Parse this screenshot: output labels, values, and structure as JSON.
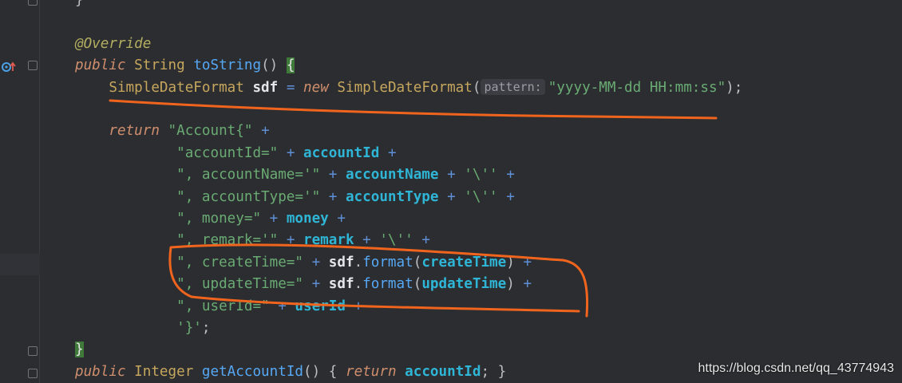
{
  "code_lines": [
    {
      "tokens": [
        {
          "t": "}",
          "c": "pn"
        }
      ]
    },
    {
      "tokens": []
    },
    {
      "tokens": [
        {
          "t": "@Override",
          "c": "ann"
        }
      ]
    },
    {
      "tokens": [
        {
          "t": "public ",
          "c": "kw"
        },
        {
          "t": "String ",
          "c": "ty"
        },
        {
          "t": "toString",
          "c": "fn"
        },
        {
          "t": "() ",
          "c": "pn"
        },
        {
          "t": "{",
          "c": "bracematch"
        }
      ]
    },
    {
      "tokens": [
        {
          "t": "    SimpleDateFormat ",
          "c": "ty"
        },
        {
          "t": "sdf ",
          "c": "loc"
        },
        {
          "t": "= ",
          "c": "op"
        },
        {
          "t": "new ",
          "c": "kw-new"
        },
        {
          "t": "SimpleDateFormat",
          "c": "ty"
        },
        {
          "t": "(",
          "c": "pn"
        },
        {
          "t": "pattern:",
          "c": "hint"
        },
        {
          "t": "\"yyyy-MM-dd HH:mm:ss\"",
          "c": "st"
        },
        {
          "t": ");",
          "c": "pn"
        }
      ]
    },
    {
      "tokens": []
    },
    {
      "tokens": [
        {
          "t": "    return ",
          "c": "kw"
        },
        {
          "t": "\"Account{\" ",
          "c": "st"
        },
        {
          "t": "+",
          "c": "op"
        }
      ]
    },
    {
      "tokens": [
        {
          "t": "            \"accountId=\" ",
          "c": "st"
        },
        {
          "t": "+ ",
          "c": "op"
        },
        {
          "t": "accountId ",
          "c": "fld"
        },
        {
          "t": "+",
          "c": "op"
        }
      ]
    },
    {
      "tokens": [
        {
          "t": "            \", accountName='\" ",
          "c": "st"
        },
        {
          "t": "+ ",
          "c": "op"
        },
        {
          "t": "accountName ",
          "c": "fld"
        },
        {
          "t": "+ ",
          "c": "op"
        },
        {
          "t": "'\\'' ",
          "c": "st"
        },
        {
          "t": "+",
          "c": "op"
        }
      ]
    },
    {
      "tokens": [
        {
          "t": "            \", accountType='\" ",
          "c": "st"
        },
        {
          "t": "+ ",
          "c": "op"
        },
        {
          "t": "accountType ",
          "c": "fld"
        },
        {
          "t": "+ ",
          "c": "op"
        },
        {
          "t": "'\\'' ",
          "c": "st"
        },
        {
          "t": "+",
          "c": "op"
        }
      ]
    },
    {
      "tokens": [
        {
          "t": "            \", money=\" ",
          "c": "st"
        },
        {
          "t": "+ ",
          "c": "op"
        },
        {
          "t": "money ",
          "c": "fld"
        },
        {
          "t": "+",
          "c": "op"
        }
      ]
    },
    {
      "tokens": [
        {
          "t": "            \", remark='\" ",
          "c": "st"
        },
        {
          "t": "+ ",
          "c": "op"
        },
        {
          "t": "remark ",
          "c": "fld"
        },
        {
          "t": "+ ",
          "c": "op"
        },
        {
          "t": "'\\'' ",
          "c": "st"
        },
        {
          "t": "+",
          "c": "op"
        }
      ]
    },
    {
      "tokens": [
        {
          "t": "            \", createTime=\" ",
          "c": "st"
        },
        {
          "t": "+ ",
          "c": "op"
        },
        {
          "t": "sdf",
          "c": "loc"
        },
        {
          "t": ".",
          "c": "pn"
        },
        {
          "t": "format",
          "c": "fn"
        },
        {
          "t": "(",
          "c": "pn"
        },
        {
          "t": "createTime",
          "c": "fld"
        },
        {
          "t": ") ",
          "c": "pn"
        },
        {
          "t": "+",
          "c": "op"
        }
      ]
    },
    {
      "tokens": [
        {
          "t": "            \", updateTime=\" ",
          "c": "st"
        },
        {
          "t": "+ ",
          "c": "op"
        },
        {
          "t": "sdf",
          "c": "loc"
        },
        {
          "t": ".",
          "c": "pn"
        },
        {
          "t": "format",
          "c": "fn"
        },
        {
          "t": "(",
          "c": "pn"
        },
        {
          "t": "updateTime",
          "c": "fld"
        },
        {
          "t": ") ",
          "c": "pn"
        },
        {
          "t": "+",
          "c": "op"
        }
      ]
    },
    {
      "tokens": [
        {
          "t": "            \", userId=\" ",
          "c": "st"
        },
        {
          "t": "+ ",
          "c": "op"
        },
        {
          "t": "userId ",
          "c": "fld"
        },
        {
          "t": "+",
          "c": "op"
        }
      ]
    },
    {
      "tokens": [
        {
          "t": "            '}'",
          "c": "st"
        },
        {
          "t": ";",
          "c": "pn"
        }
      ]
    },
    {
      "tokens": [
        {
          "t": "}",
          "c": "bracematch2"
        }
      ]
    },
    {
      "tokens": [
        {
          "t": "public ",
          "c": "kw"
        },
        {
          "t": "Integer ",
          "c": "ty"
        },
        {
          "t": "getAccountId",
          "c": "fn"
        },
        {
          "t": "() ",
          "c": "pn"
        },
        {
          "t": "{ ",
          "c": "pn"
        },
        {
          "t": "return ",
          "c": "kw"
        },
        {
          "t": "accountId",
          "c": "fld"
        },
        {
          "t": "; ",
          "c": "pn"
        },
        {
          "t": "}",
          "c": "pn"
        }
      ]
    }
  ],
  "gutter_icons": {
    "override_marker": "override-method-icon",
    "fold_markers": "fold-icon"
  },
  "colors": {
    "background": "#2b2d30",
    "annotation_stroke": "#f0641e"
  },
  "watermark": "https://blog.csdn.net/qq_43774943"
}
